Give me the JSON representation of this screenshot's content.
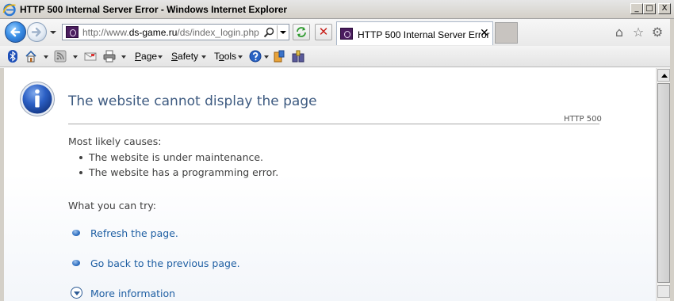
{
  "window": {
    "title": "HTTP 500 Internal Server Error - Windows Internet Explorer",
    "minimize_glyph": "_",
    "maximize_glyph": "□",
    "close_glyph": "X"
  },
  "navbar": {
    "address_prefix": "http://www.",
    "address_domain": "ds-game.ru",
    "address_path": "/ds/index_login.php",
    "stop_glyph": "✕",
    "tab_title": "HTTP 500 Internal Server Error",
    "tab_close_glyph": "✕",
    "home_glyph": "⌂",
    "favorites_glyph": "☆",
    "tools_glyph": "⚙"
  },
  "commandbar": {
    "page_menu_underlined": "P",
    "page_menu_rest": "age",
    "safety_menu_underlined": "S",
    "safety_menu_rest": "afety",
    "tools_menu_first": "T",
    "tools_menu_underlined": "o",
    "tools_menu_rest": "ols"
  },
  "content": {
    "heading": "The website cannot display the page",
    "http_code": "HTTP 500",
    "causes_label": "Most likely causes:",
    "causes": [
      "The website is under maintenance.",
      "The website has a programming error."
    ],
    "try_label": "What you can try:",
    "actions": [
      "Refresh the page.",
      "Go back to the previous page."
    ],
    "more_info": "More information"
  },
  "colors": {
    "heading": "#3d5a80",
    "link": "#1f5fa3",
    "body_text": "#404040"
  },
  "icons": {
    "ie_logo": "ie-logo-icon",
    "back": "back-arrow-icon",
    "forward": "forward-arrow-icon",
    "search": "search-icon",
    "refresh": "refresh-icon",
    "stop": "stop-icon",
    "home": "home-icon",
    "favorites": "favorites-star-icon",
    "tools": "gear-icon",
    "info": "info-icon"
  }
}
